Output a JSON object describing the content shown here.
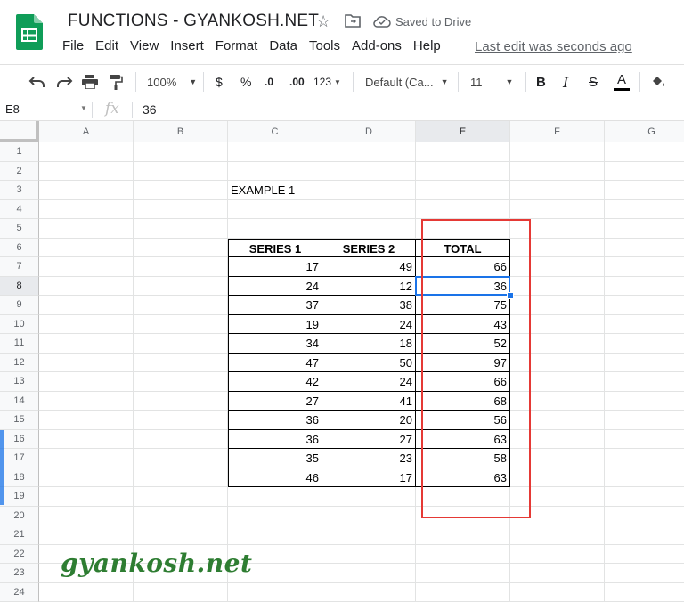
{
  "doc": {
    "title": "FUNCTIONS - GYANKOSH.NET",
    "saved_status": "Saved to Drive",
    "last_edit": "Last edit was seconds ago"
  },
  "menu": [
    "File",
    "Edit",
    "View",
    "Insert",
    "Format",
    "Data",
    "Tools",
    "Add-ons",
    "Help"
  ],
  "toolbar": {
    "zoom": "100%",
    "currency": "$",
    "percent": "%",
    "decimal_decrease": ".0",
    "decimal_increase": ".00",
    "more_formats": "123",
    "font": "Default (Ca...",
    "font_size": "11",
    "bold": "B",
    "italic": "I",
    "strikethrough": "S",
    "text_color": "A"
  },
  "formula_bar": {
    "name_box": "E8",
    "fx": "fx",
    "value": "36"
  },
  "columns": [
    "A",
    "B",
    "C",
    "D",
    "E",
    "F",
    "G"
  ],
  "rows": [
    "1",
    "2",
    "3",
    "4",
    "5",
    "6",
    "7",
    "8",
    "9",
    "10",
    "11",
    "12",
    "13",
    "14",
    "15",
    "16",
    "17",
    "18",
    "19",
    "20",
    "21",
    "22",
    "23",
    "24"
  ],
  "sheet": {
    "example_label": "EXAMPLE 1",
    "headers": [
      "SERIES 1",
      "SERIES 2",
      "TOTAL"
    ],
    "data": [
      [
        17,
        49,
        66
      ],
      [
        24,
        12,
        36
      ],
      [
        37,
        38,
        75
      ],
      [
        19,
        24,
        43
      ],
      [
        34,
        18,
        52
      ],
      [
        47,
        50,
        97
      ],
      [
        42,
        24,
        66
      ],
      [
        27,
        41,
        68
      ],
      [
        36,
        20,
        56
      ],
      [
        36,
        27,
        63
      ],
      [
        35,
        23,
        58
      ],
      [
        46,
        17,
        63
      ]
    ]
  },
  "watermark": "gyankosh.net",
  "colors": {
    "selection": "#1a73e8",
    "highlight_box": "#e53935",
    "watermark": "#2e7d32",
    "sheets_green": "#0f9d58"
  }
}
